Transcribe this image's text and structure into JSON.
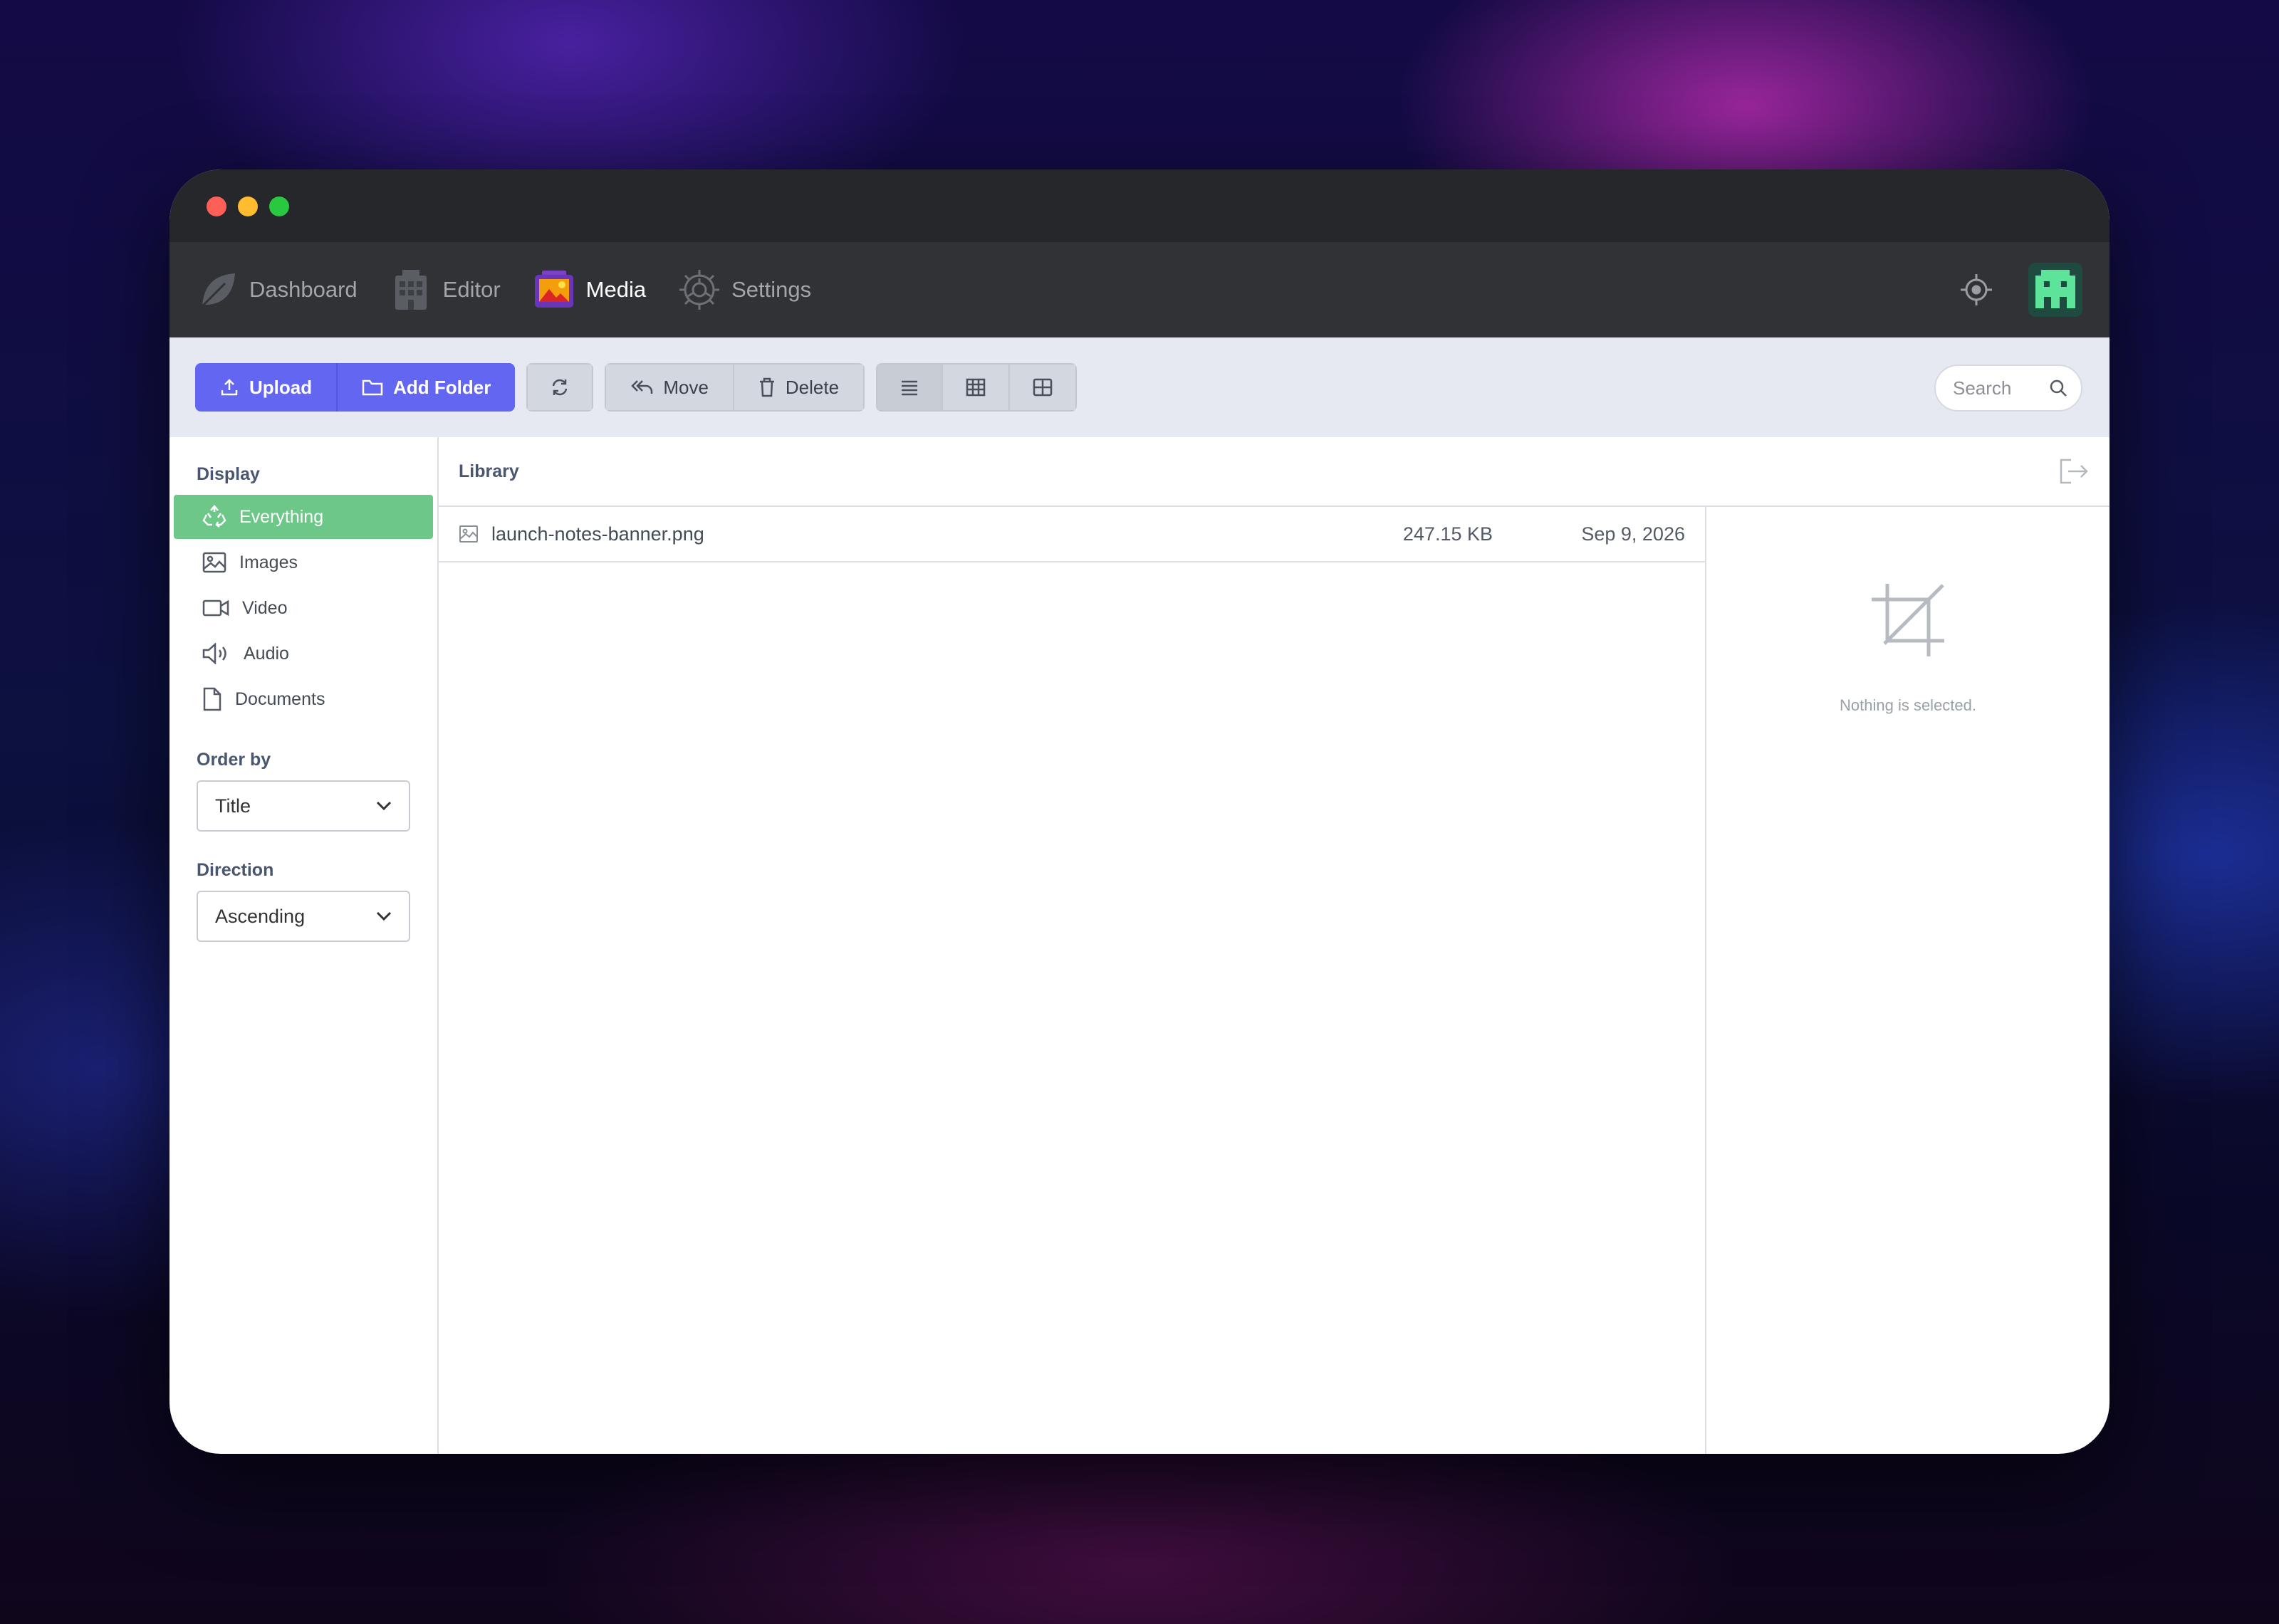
{
  "nav": {
    "items": [
      {
        "label": "Dashboard",
        "icon": "leaf-icon"
      },
      {
        "label": "Editor",
        "icon": "building-icon"
      },
      {
        "label": "Media",
        "icon": "image-gallery-icon"
      },
      {
        "label": "Settings",
        "icon": "gear-icon"
      }
    ],
    "active": "Media"
  },
  "toolbar": {
    "upload_label": "Upload",
    "add_folder_label": "Add Folder",
    "move_label": "Move",
    "delete_label": "Delete",
    "search_placeholder": "Search"
  },
  "sidebar": {
    "display_heading": "Display",
    "filters": [
      {
        "label": "Everything",
        "icon": "recycle-icon",
        "active": true
      },
      {
        "label": "Images",
        "icon": "image-icon"
      },
      {
        "label": "Video",
        "icon": "video-camera-icon"
      },
      {
        "label": "Audio",
        "icon": "speaker-icon"
      },
      {
        "label": "Documents",
        "icon": "document-icon"
      }
    ],
    "order_heading": "Order by",
    "order_value": "Title",
    "direction_heading": "Direction",
    "direction_value": "Ascending"
  },
  "library": {
    "title": "Library",
    "files": [
      {
        "name": "launch-notes-banner.png",
        "size": "247.15 KB",
        "date": "Sep 9, 2026"
      }
    ]
  },
  "details": {
    "empty_text": "Nothing is selected."
  },
  "colors": {
    "primary": "#6366f1",
    "active_filter": "#6dc789",
    "nav_bg": "#303235",
    "titlebar_bg": "#25272b"
  }
}
